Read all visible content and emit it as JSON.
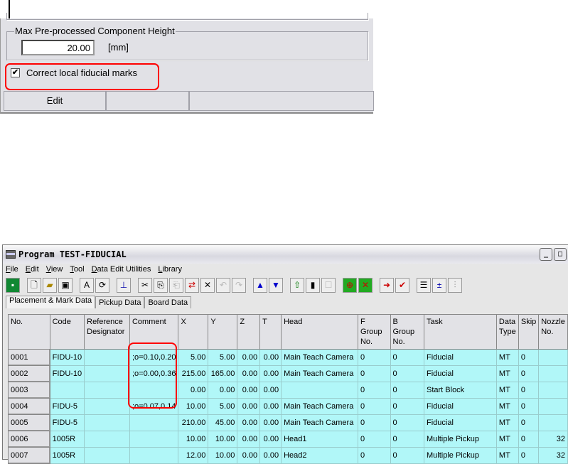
{
  "settings_panel": {
    "group_label": "Max Pre-processed Component Height",
    "height_value": "20.00",
    "height_unit": "[mm]",
    "checkbox_label": "Correct local fiducial marks",
    "checkbox_checked": true,
    "status_cells": [
      "Edit",
      "",
      ""
    ]
  },
  "window": {
    "title": "Program TEST-FIDUCIAL",
    "menu": [
      "File",
      "Edit",
      "View",
      "Tool",
      "Data Edit Utilities",
      "Library"
    ],
    "tabs": [
      "Placement & Mark Data",
      "Pickup Data",
      "Board Data"
    ],
    "columns": [
      "No.",
      "Code",
      "Reference Designator",
      "Comment",
      "X",
      "Y",
      "Z",
      "T",
      "Head",
      "F Group No.",
      "B Group No.",
      "Task",
      "Data Type",
      "Skip",
      "Nozzle No."
    ],
    "rows": [
      [
        "0001",
        "FIDU-10",
        "",
        ";o=0.10,0.20",
        "5.00",
        "5.00",
        "0.00",
        "0.00",
        "Main Teach Camera",
        "0",
        "0",
        "Fiducial",
        "MT",
        "0",
        ""
      ],
      [
        "0002",
        "FIDU-10",
        "",
        ";o=0.00,0.36",
        "215.00",
        "165.00",
        "0.00",
        "0.00",
        "Main Teach Camera",
        "0",
        "0",
        "Fiducial",
        "MT",
        "0",
        ""
      ],
      [
        "0003",
        "",
        "",
        "",
        "0.00",
        "0.00",
        "0.00",
        "0.00",
        "",
        "0",
        "0",
        "Start Block",
        "MT",
        "0",
        ""
      ],
      [
        "0004",
        "FIDU-5",
        "",
        ";o=0.07,0.14",
        "10.00",
        "5.00",
        "0.00",
        "0.00",
        "Main Teach Camera",
        "0",
        "0",
        "Fiducial",
        "MT",
        "0",
        ""
      ],
      [
        "0005",
        "FIDU-5",
        "",
        "",
        "210.00",
        "45.00",
        "0.00",
        "0.00",
        "Main Teach Camera",
        "0",
        "0",
        "Fiducial",
        "MT",
        "0",
        ""
      ],
      [
        "0006",
        "1005R",
        "",
        "",
        "10.00",
        "10.00",
        "0.00",
        "0.00",
        "Head1",
        "0",
        "0",
        "Multiple Pickup",
        "MT",
        "0",
        "32"
      ],
      [
        "0007",
        "1005R",
        "",
        "",
        "12.00",
        "10.00",
        "0.00",
        "0.00",
        "Head2",
        "0",
        "0",
        "Multiple Pickup",
        "MT",
        "0",
        "32"
      ]
    ]
  },
  "colors": {
    "row_bg": "#b1f7f8",
    "highlight": "#ff0000"
  }
}
